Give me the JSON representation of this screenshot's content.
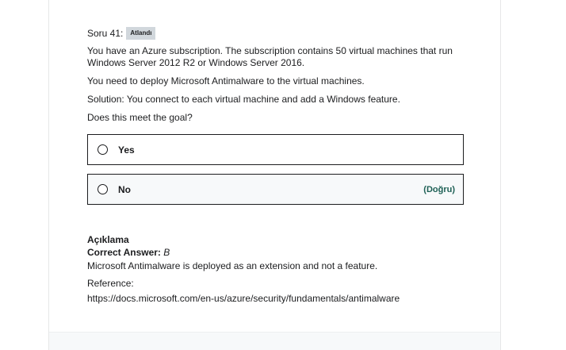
{
  "question": {
    "number_label": "Soru 41:",
    "status_badge": "Atlandı",
    "paragraphs": [
      "You have an Azure subscription. The subscription contains 50 virtual machines that run Windows Server 2012 R2 or Windows Server 2016.",
      "You need to deploy Microsoft Antimalware to the virtual machines.",
      "Solution: You connect to each virtual machine and add a Windows feature.",
      "Does this meet the goal?"
    ],
    "options": [
      {
        "label": "Yes",
        "tag": ""
      },
      {
        "label": "No",
        "tag": "(Doğru)"
      }
    ]
  },
  "explanation": {
    "title": "Açıklama",
    "answer_key": "Correct Answer:",
    "answer_value": "B",
    "text": "Microsoft Antimalware is deployed as an extension and not a feature.",
    "reference_label": "Reference:",
    "reference_url": "https://docs.microsoft.com/en-us/azure/security/fundamentals/antimalware"
  }
}
